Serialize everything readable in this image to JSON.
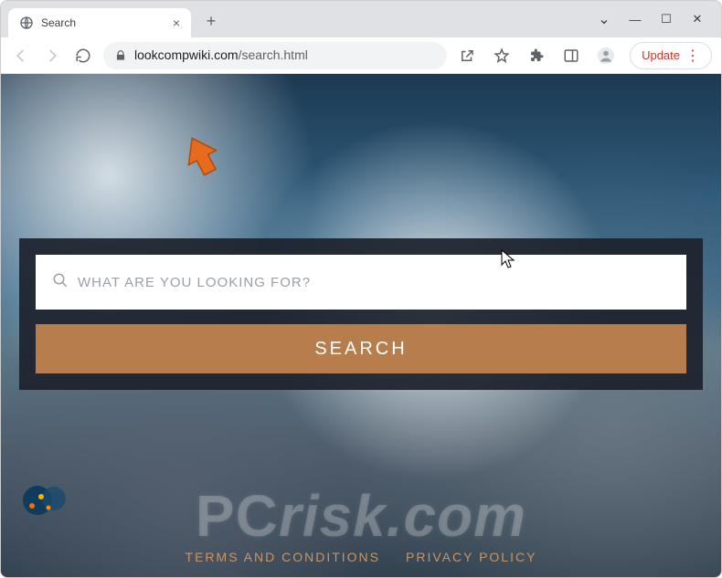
{
  "tab": {
    "title": "Search"
  },
  "toolbar": {
    "url_host": "lookcompwiki.com",
    "url_path": "/search.html",
    "update_label": "Update"
  },
  "page": {
    "search_placeholder": "WHAT ARE YOU LOOKING FOR?",
    "search_button": "SEARCH",
    "terms_label": "TERMS AND CONDITIONS",
    "privacy_label": "PRIVACY POLICY"
  },
  "watermark": {
    "text": "PCrisk.com"
  }
}
